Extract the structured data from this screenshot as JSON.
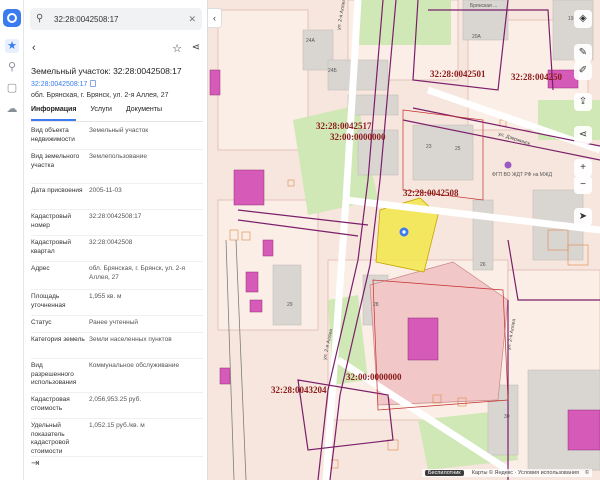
{
  "search": {
    "value": "32:28:0042508:17"
  },
  "panel": {
    "title": "Земельный участок: 32:28:0042508:17",
    "subid": "32:28:0042508:17",
    "address": "обл. Брянская, г. Брянск, ул. 2-я Аллея, 27",
    "tabs": [
      {
        "label": "Информация"
      },
      {
        "label": "Услуги"
      },
      {
        "label": "Документы"
      }
    ],
    "rows": [
      {
        "k": "Вид объекта недвижимости",
        "v": "Земельный участок"
      },
      {
        "k": "Вид земельного участка",
        "v": "Землепользование"
      },
      {
        "k": "Дата присвоения",
        "v": "2005-11-03"
      },
      {
        "k": "Кадастровый номер",
        "v": "32:28:0042508:17"
      },
      {
        "k": "Кадастровый квартал",
        "v": "32:28:0042508"
      },
      {
        "k": "Адрес",
        "v": "обл. Брянская, г. Брянск, ул. 2-я Аллея, 27"
      },
      {
        "k": "Площадь уточненная",
        "v": "1,955 кв. м"
      },
      {
        "k": "Статус",
        "v": "Ранее учтенный"
      },
      {
        "k": "Категория земель",
        "v": "Земли населенных пунктов"
      },
      {
        "k": "Вид разрешенного использования",
        "v": "Коммунальное обслуживание"
      },
      {
        "k": "Кадастровая стоимость",
        "v": "2,056,953.25 руб."
      },
      {
        "k": "Удельный показатель кадастровой стоимости",
        "v": "1,052.15 руб./кв. м"
      }
    ]
  },
  "map": {
    "cad_labels": [
      "32:28:0042501",
      "32:28:004250",
      "32:28:0042517",
      "32:00:0000000",
      "32:28:0042508",
      "32:00:0000000",
      "32:28:0043204"
    ],
    "streets": [
      "ул. 2-я Аллея",
      "ул. 2-я Аллея",
      "ул. Дзержинск",
      "ул. 2-я Аллея"
    ],
    "buildings": [
      "24А",
      "24Б",
      "23",
      "25",
      "29",
      "26",
      "28",
      "30",
      "20А",
      "19"
    ],
    "poi": "ФГП ВО ЖДТ РФ на МЖД",
    "poi_top": "Брянская ... "
  },
  "attribution": {
    "chip": "Беспилотник",
    "text": "Карты © Яндекс · Условия использования",
    "c": "©"
  },
  "colors": {
    "accent": "#3a7bf0",
    "cadastral": "#8b1a1a",
    "parcel_fill": "#f3e64a",
    "boundary": "#7b1f6a"
  }
}
